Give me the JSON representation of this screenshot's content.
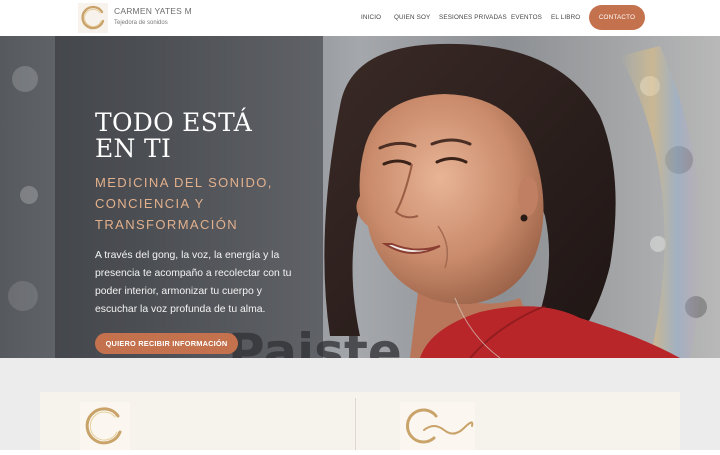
{
  "header": {
    "brand_name": "CARMEN YATES M",
    "brand_tagline": "Tejedora de sonidos",
    "nav": [
      "INICIO",
      "QUIEN SOY",
      "SESIONES PRIVADAS",
      "EVENTOS",
      "EL LIBRO"
    ],
    "contact_label": "CONTACTO"
  },
  "hero": {
    "title": "TODO ESTÁ EN TI",
    "subtitle": "MEDICINA DEL SONIDO, CONCIENCIA Y TRANSFORMACIÓN",
    "body": "A través del gong, la voz, la energía y la presencia te acompaño a recolectar con tu poder interior, armonizar tu cuerpo y escuchar la voz profunda de tu alma.",
    "background_text": "Paiste",
    "cta_label": "QUIERO RECIBIR INFORMACIÓN"
  },
  "colors": {
    "accent": "#c4714e",
    "subtitle": "#e2b08c",
    "gold_ring": "#c9a36a"
  },
  "icons": {
    "brand_logo": "gold-ring-icon",
    "card_1_logo": "gold-ring-icon",
    "card_2_logo": "gold-ring-wave-icon"
  }
}
